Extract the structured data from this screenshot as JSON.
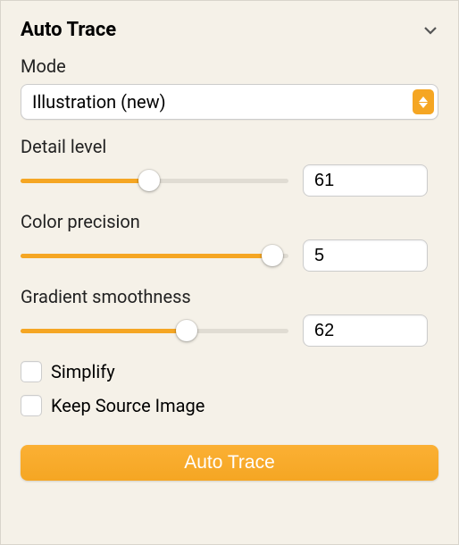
{
  "panel": {
    "title": "Auto Trace"
  },
  "mode": {
    "label": "Mode",
    "selected": "Illustration (new)"
  },
  "sliders": {
    "detail": {
      "label": "Detail level",
      "value": "61",
      "fillPercent": 48,
      "thumbPercent": 48
    },
    "color": {
      "label": "Color precision",
      "value": "5",
      "fillPercent": 94,
      "thumbPercent": 94
    },
    "gradient": {
      "label": "Gradient smoothness",
      "value": "62",
      "fillPercent": 62,
      "thumbPercent": 62
    }
  },
  "checkboxes": {
    "simplify": {
      "label": "Simplify",
      "checked": false
    },
    "keepSource": {
      "label": "Keep Source Image",
      "checked": false
    }
  },
  "action": {
    "label": "Auto Trace"
  },
  "colors": {
    "accent": "#f5a623",
    "background": "#f5f1e8"
  }
}
